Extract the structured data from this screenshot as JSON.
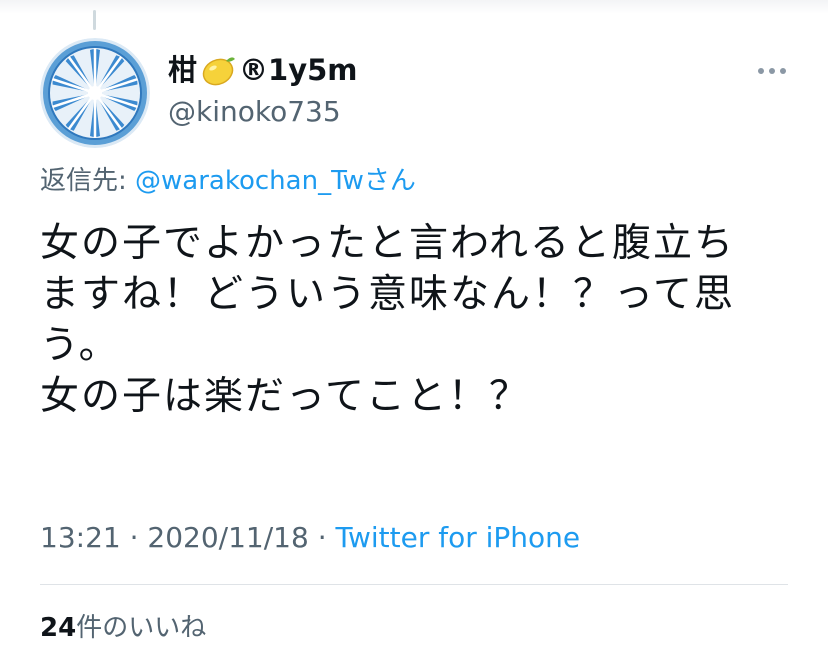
{
  "tweet": {
    "author": {
      "display_name": "柑",
      "display_name_suffix": "®1y5m",
      "emoji": "lemon-emoji",
      "handle": "@kinoko735",
      "avatar": "blue-citrus-slice-avatar"
    },
    "reply_to": {
      "prefix": "返信先: ",
      "mention": "@warakochan_Tw",
      "suffix": "さん"
    },
    "text_lines": [
      "女の子でよかったと言われると腹立ち",
      "ますね！どういう意味なん！？って思",
      "う。",
      "女の子は楽だってこと！？"
    ],
    "time": "13:21",
    "separator": " · ",
    "date": "2020/11/18",
    "source": "Twitter for iPhone",
    "likes_count": "24",
    "likes_label": "件のいいね"
  },
  "colors": {
    "accent": "#1d9bf0",
    "secondary_text": "#536471",
    "primary_text": "#0f1419",
    "divider": "#dfe3e7"
  }
}
